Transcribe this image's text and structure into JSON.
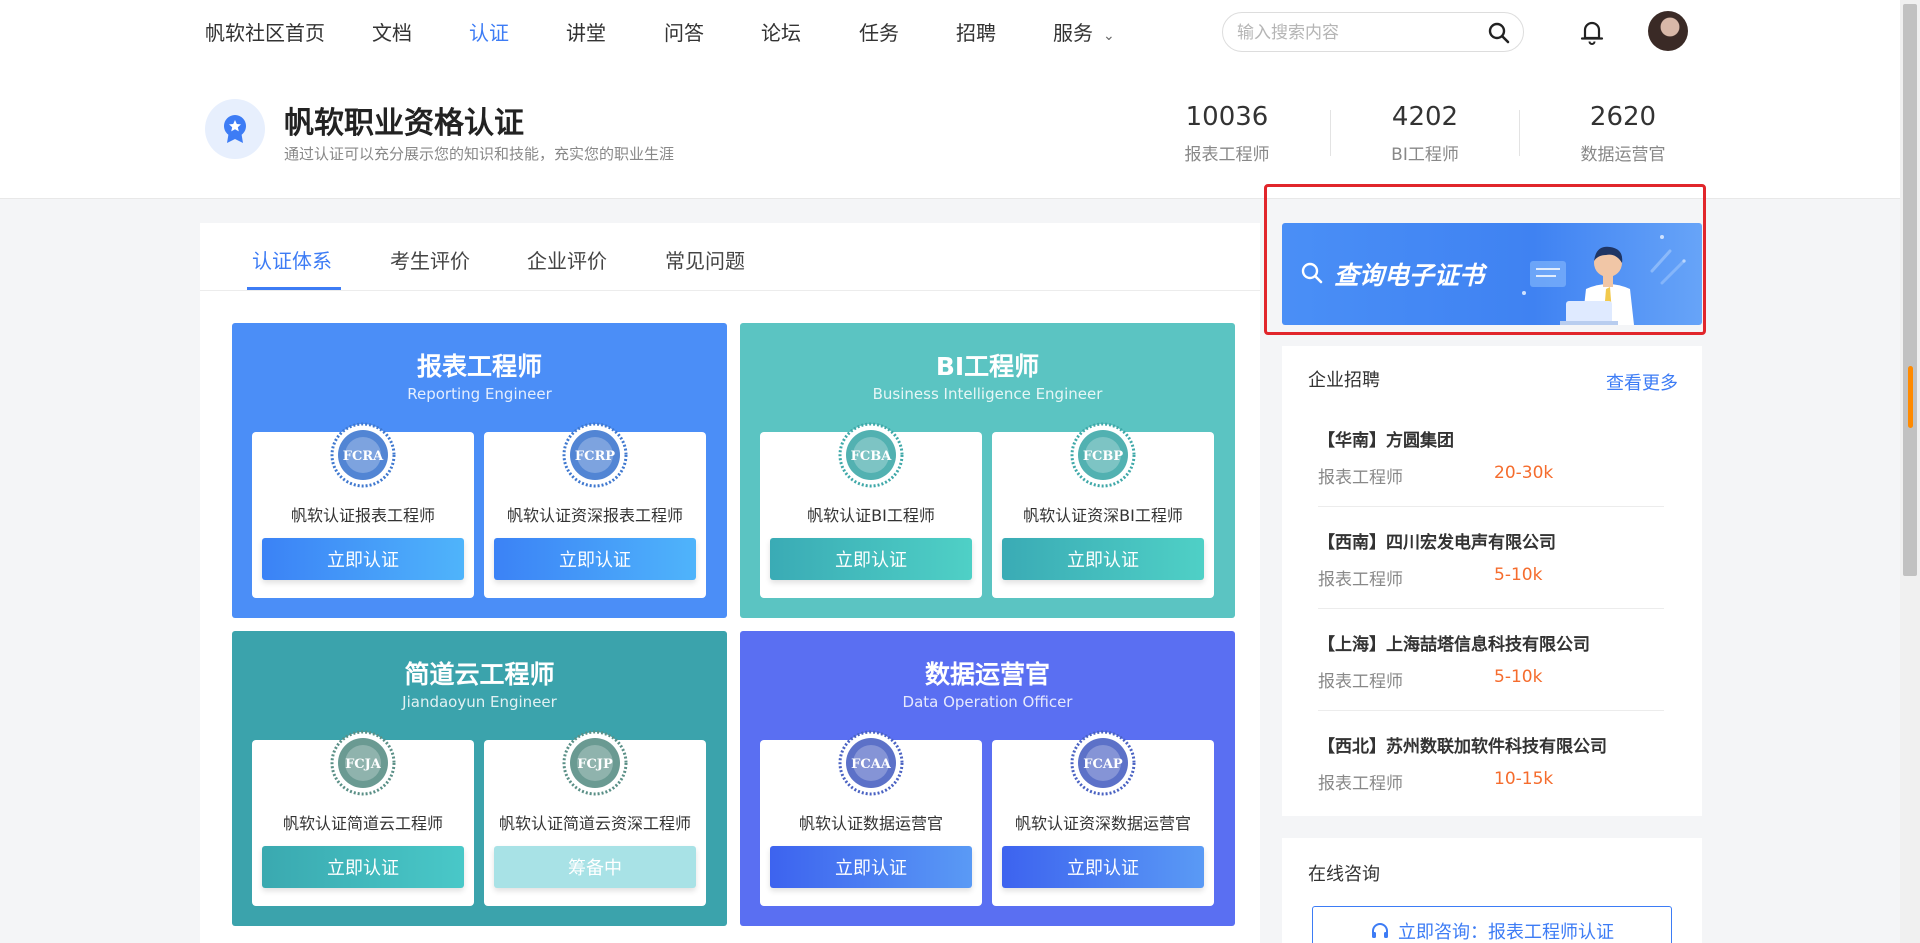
{
  "nav": {
    "items": [
      "帆软社区首页",
      "文档",
      "认证",
      "讲堂",
      "问答",
      "论坛",
      "任务",
      "招聘",
      "服务"
    ],
    "active": "认证",
    "search_placeholder": "输入搜索内容",
    "icons": {
      "search": "search-icon",
      "bell": "bell-icon",
      "dropdown": "chevron-down-icon"
    }
  },
  "header": {
    "title": "帆软职业资格认证",
    "subtitle": "通过认证可以充分展示您的知识和技能，充实您的职业生涯",
    "stats": [
      {
        "value": "10036",
        "label": "报表工程师"
      },
      {
        "value": "4202",
        "label": "BI工程师"
      },
      {
        "value": "2620",
        "label": "数据运营官"
      }
    ]
  },
  "tabs": [
    "认证体系",
    "考生评价",
    "企业评价",
    "常见问题"
  ],
  "cert_groups": [
    {
      "title": "报表工程师",
      "subtitle": "Reporting Engineer",
      "color": "#4b8ef7",
      "certs": [
        {
          "code": "FCRA",
          "name": "帆软认证报表工程师",
          "button": "立即认证",
          "seal_color": "#3f78cf"
        },
        {
          "code": "FCRP",
          "name": "帆软认证资深报表工程师",
          "button": "立即认证",
          "seal_color": "#3f78cf"
        }
      ]
    },
    {
      "title": "BI工程师",
      "subtitle": "Business Intelligence Engineer",
      "color": "#5bc4c2",
      "certs": [
        {
          "code": "FCBA",
          "name": "帆软认证BI工程师",
          "button": "立即认证",
          "seal_color": "#3fa8a8"
        },
        {
          "code": "FCBP",
          "name": "帆软认证资深BI工程师",
          "button": "立即认证",
          "seal_color": "#3fa8a8"
        }
      ]
    },
    {
      "title": "简道云工程师",
      "subtitle": "Jiandaoyun Engineer",
      "color": "#3ba3ac",
      "certs": [
        {
          "code": "FCJA",
          "name": "帆软认证简道云工程师",
          "button": "立即认证",
          "seal_color": "#5a8f86"
        },
        {
          "code": "FCJP",
          "name": "帆软认证简道云资深工程师",
          "button": "筹备中",
          "seal_color": "#5a8f86"
        }
      ]
    },
    {
      "title": "数据运营官",
      "subtitle": "Data Operation Officer",
      "color": "#5a6ff2",
      "certs": [
        {
          "code": "FCAA",
          "name": "帆软认证数据运营官",
          "button": "立即认证",
          "seal_color": "#4a62c2"
        },
        {
          "code": "FCAP",
          "name": "帆软认证资深数据运营官",
          "button": "立即认证",
          "seal_color": "#4a62c2"
        }
      ]
    }
  ],
  "promo": {
    "text": "查询电子证书",
    "icon": "search-icon"
  },
  "jobs": {
    "title": "企业招聘",
    "more": "查看更多",
    "items": [
      {
        "company": "【华南】方圆集团",
        "role": "报表工程师",
        "salary": "20-30k"
      },
      {
        "company": "【西南】四川宏发电声有限公司",
        "role": "报表工程师",
        "salary": "5-10k"
      },
      {
        "company": "【上海】上海喆塔信息科技有限公司",
        "role": "报表工程师",
        "salary": "5-10k"
      },
      {
        "company": "【西北】苏州数联加软件科技有限公司",
        "role": "报表工程师",
        "salary": "10-15k"
      }
    ]
  },
  "consult": {
    "title": "在线咨询",
    "button": "立即咨询：报表工程师认证",
    "icon": "headset-icon"
  }
}
